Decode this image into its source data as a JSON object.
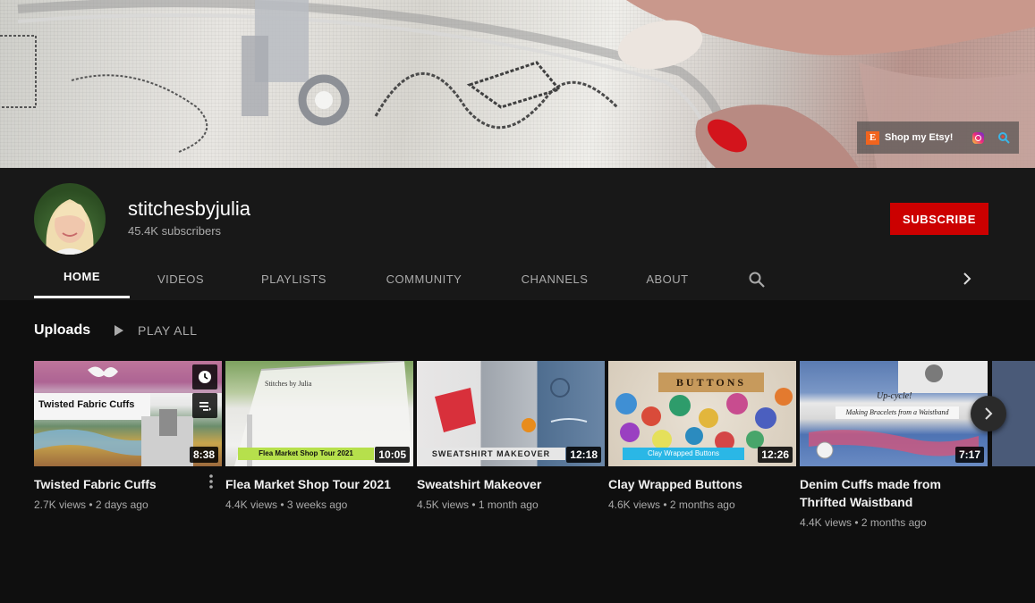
{
  "banner": {
    "etsy_badge": "E",
    "etsy_label": "Shop my Etsy!"
  },
  "channel": {
    "name": "stitchesbyjulia",
    "subscribers": "45.4K subscribers",
    "subscribe_label": "SUBSCRIBE"
  },
  "tabs": [
    "HOME",
    "VIDEOS",
    "PLAYLISTS",
    "COMMUNITY",
    "CHANNELS",
    "ABOUT"
  ],
  "shelf": {
    "title": "Uploads",
    "play_all": "PLAY ALL"
  },
  "videos": [
    {
      "title": "Twisted Fabric Cuffs",
      "views": "2.7K views",
      "age": "2 days ago",
      "duration": "8:38",
      "overlay": "Twisted Fabric Cuffs"
    },
    {
      "title": "Flea Market Shop Tour 2021",
      "views": "4.4K views",
      "age": "3 weeks ago",
      "duration": "10:05",
      "overlay": "Flea Market Shop Tour 2021",
      "overlay2": "Stitches by Julia"
    },
    {
      "title": "Sweatshirt Makeover",
      "views": "4.5K views",
      "age": "1 month ago",
      "duration": "12:18",
      "overlay": "SWEATSHIRT MAKEOVER"
    },
    {
      "title": "Clay Wrapped Buttons",
      "views": "4.6K views",
      "age": "2 months ago",
      "duration": "12:26",
      "overlay": "Clay Wrapped Buttons",
      "overlay2": "BUTTONS"
    },
    {
      "title": "Denim Cuffs made from Thrifted Waistband",
      "views": "4.4K views",
      "age": "2 months ago",
      "duration": "7:17",
      "overlay": "Making Bracelets from a Waistband",
      "overlay2": "Up-cycle!"
    }
  ],
  "meta_separator": "•",
  "colors": {
    "background": "#0f0f0f",
    "header": "#181818",
    "subscribe": "#cc0000",
    "etsy": "#f1641e"
  }
}
